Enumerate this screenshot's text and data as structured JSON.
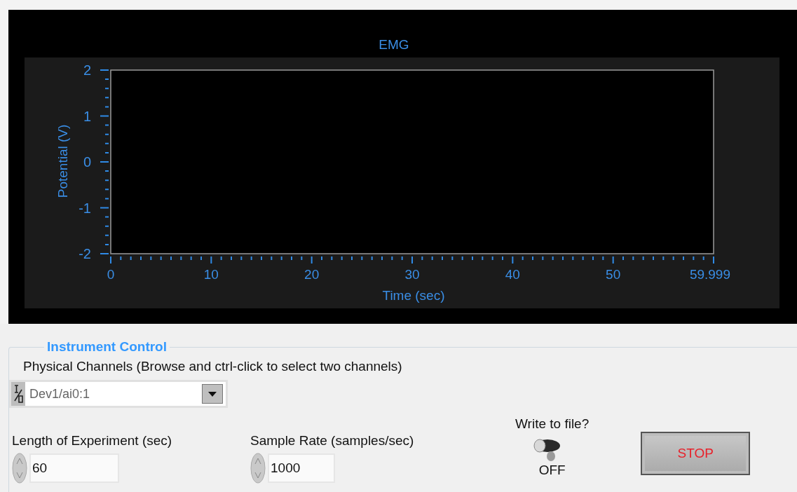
{
  "chart": {
    "chart_data": {
      "type": "line",
      "title": "EMG",
      "xlabel": "Time (sec)",
      "ylabel": "Potential (V)",
      "xlim": [
        0,
        59.999
      ],
      "ylim": [
        -2,
        2
      ],
      "xticks": [
        0,
        10,
        20,
        30,
        40,
        50,
        59.999
      ],
      "yticks": [
        -2,
        -1,
        0,
        1,
        2
      ]
    }
  },
  "instrument_control": {
    "title": "Instrument Control",
    "physical_channels": {
      "label": "Physical Channels (Browse and ctrl-click to select two channels)",
      "value": "Dev1/ai0:1"
    },
    "length": {
      "label": "Length of Experiment (sec)",
      "value": "60"
    },
    "sample_rate": {
      "label": "Sample Rate (samples/sec)",
      "value": "1000"
    },
    "write_to_file": {
      "label": "Write to file?",
      "on": false,
      "state_text": "OFF"
    },
    "stop_button": {
      "label": "STOP"
    }
  }
}
